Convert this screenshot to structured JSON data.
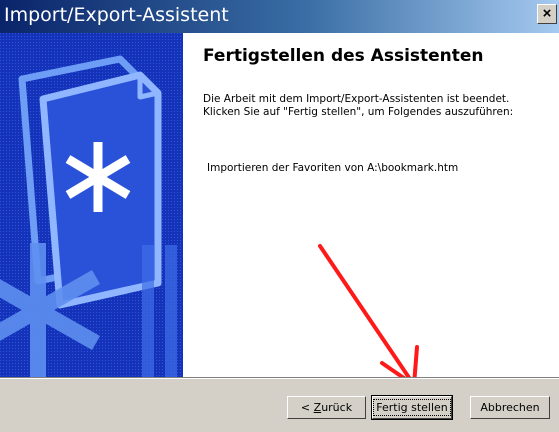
{
  "window": {
    "title": "Import/Export-Assistent",
    "close_icon": "close-icon",
    "close_glyph": "×"
  },
  "page": {
    "heading": "Fertigstellen des Assistenten",
    "description_lines": [
      "Die Arbeit mit dem Import/Export-Assistenten ist beendet.",
      "Klicken Sie auf \"Fertig stellen\", um Folgendes auszuführen:"
    ],
    "summary": "Importieren der Favoriten von A:\\bookmark.htm"
  },
  "buttons": {
    "back_prefix": "< ",
    "back_mnemonic": "Z",
    "back_rest": "urück",
    "finish": "Fertig stellen",
    "cancel": "Abbrechen"
  },
  "colors": {
    "titlebar_start": "#0a246a",
    "titlebar_end": "#a6caf0",
    "sidebar_blue": "#1230b0",
    "annotation_arrow": "#ff0000",
    "button_face": "#d4d0c8"
  },
  "icons": {
    "wizard_graphic": "document-stack-asterisk-graphic",
    "annotation": "red-arrow-annotation"
  }
}
